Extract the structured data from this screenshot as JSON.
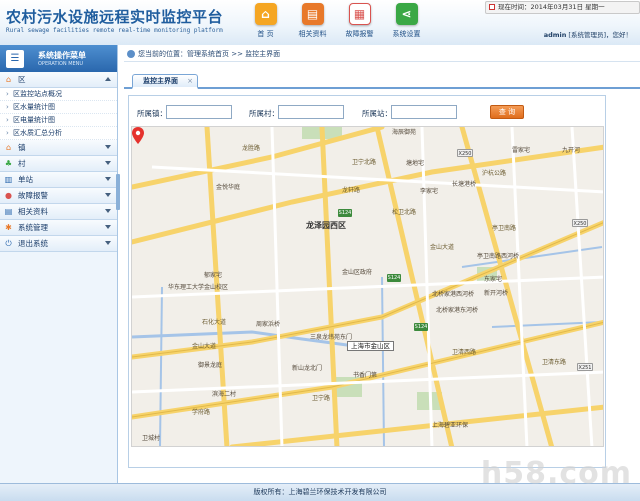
{
  "header": {
    "title": "农村污水设施远程实时监控平台",
    "subtitle": "Rural sewage facilities remote real-time monitoring platform",
    "nav": [
      {
        "label": "首 页",
        "icon": "home-icon",
        "color": "#f5a623",
        "glyph": "⌂"
      },
      {
        "label": "相关资料",
        "icon": "document-icon",
        "color": "#e8792a",
        "glyph": "▤"
      },
      {
        "label": "故障报警",
        "icon": "alarm-icon",
        "color": "#d9534f",
        "glyph": "▦"
      },
      {
        "label": "系统设置",
        "icon": "share-settings-icon",
        "color": "#3aa845",
        "glyph": "⋖"
      }
    ],
    "datetime": "现在时间：2014年03月31日 星期一",
    "user": "admin",
    "user_suffix": " [系统管理员]，您好！"
  },
  "sidebar": {
    "title": "系统操作菜单",
    "subtitle": "OPERATION MENU",
    "menu": [
      {
        "label": "区",
        "icon": "home-icon",
        "open": true,
        "children": [
          "区监控站点概况",
          "区水量统计图",
          "区电量统计图",
          "区水质汇总分析"
        ]
      },
      {
        "label": "镇",
        "icon": "home-icon"
      },
      {
        "label": "村",
        "icon": "tree-icon"
      },
      {
        "label": "单站",
        "icon": "chart-icon"
      },
      {
        "label": "故障报警",
        "icon": "alarm-icon"
      },
      {
        "label": "相关资料",
        "icon": "document-icon"
      },
      {
        "label": "系统管理",
        "icon": "settings-icon"
      },
      {
        "label": "退出系统",
        "icon": "logout-icon"
      }
    ]
  },
  "breadcrumb": "您当前的位置：管理系统首页 >> 监控主界面",
  "tab": {
    "label": "监控主界面",
    "close": "×"
  },
  "filters": {
    "town_label": "所属镇：",
    "village_label": "所属村：",
    "station_label": "所属站：",
    "town_value": "",
    "village_value": "",
    "station_value": "",
    "query_button": "查 询"
  },
  "map": {
    "district": "龙泽园西区",
    "marker_label": "上海市金山区",
    "labels": [
      "海辰御苑",
      "金悦华庭",
      "金山区政府",
      "华东理工大学金山校区",
      "周家浜桥",
      "三泉龙纬苑东门",
      "新山龙北门",
      "书香门第",
      "御景龙庭",
      "滨海二村",
      "卫城村",
      "郁家宅",
      "亭卫南路西河桥",
      "北桥家港西河桥",
      "北桥家港东河桥",
      "东家宅",
      "新开河桥",
      "李家宅",
      "九开河",
      "雷家宅",
      "长塘港桥",
      "塘地宅",
      "上海碧亚环保",
      "龙胜路",
      "松卫北路",
      "卫宁路",
      "金山大道",
      "卫宁北路",
      "上海市金山区东门"
    ],
    "roads": [
      "卫宁北路",
      "龙胜路",
      "松卫北路",
      "金山大道",
      "卫宁路",
      "金山大道",
      "沪杭公路",
      "龙轩路",
      "亭卫南路",
      "学府路",
      "卫清西路",
      "卫清东路",
      "石化大道"
    ],
    "shields": [
      "X250",
      "S124",
      "S124",
      "S124",
      "X251",
      "X250"
    ]
  },
  "footer": "版权所有：上海碧兰环保技术开发有限公司",
  "watermark": "h58.com"
}
